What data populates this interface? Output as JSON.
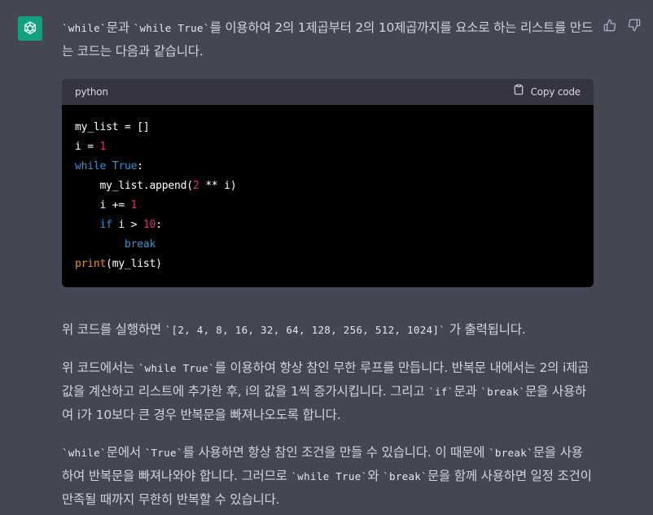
{
  "intro": {
    "c1": "`while`",
    "t1": "문과 ",
    "c2": "`while True`",
    "t2": "를 이용하여 2의 1제곱부터 2의 10제곱까지를 요소로 하는 리스트를 만드는 코드는 다음과 같습니다."
  },
  "code": {
    "language": "python",
    "copy_label": "Copy code",
    "l1": "my_list = []",
    "l2a": "i = ",
    "l2b": "1",
    "l3a": "while",
    "l3b": " ",
    "l3c": "True",
    "l3d": ":",
    "l4a": "    my_list.append(",
    "l4b": "2",
    "l4c": " ** i)",
    "l5a": "    i += ",
    "l5b": "1",
    "l6a": "    ",
    "l6b": "if",
    "l6c": " i > ",
    "l6d": "10",
    "l6e": ":",
    "l7a": "        ",
    "l7b": "break",
    "l8a": "print",
    "l8b": "(my_list)"
  },
  "result": {
    "t1": "위 코드를 실행하면 ",
    "c1": "`[2, 4, 8, 16, 32, 64, 128, 256, 512, 1024]`",
    "t2": " 가 출력됩니다."
  },
  "explain1": {
    "t1": "위 코드에서는 ",
    "c1": "`while True`",
    "t2": "를 이용하여 항상 참인 무한 루프를 만듭니다. 반복문 내에서는 2의 i제곱 값을 계산하고 리스트에 추가한 후, i의 값을 1씩 증가시킵니다. 그리고 ",
    "c2": "`if`",
    "t3": "문과 ",
    "c3": "`break`",
    "t4": "문을 사용하여 i가 10보다 큰 경우 반복문을 빠져나오도록 합니다."
  },
  "explain2": {
    "c1": "`while`",
    "t1": "문에서 ",
    "c2": "`True`",
    "t2": "를 사용하면 항상 참인 조건을 만들 수 있습니다. 이 때문에 ",
    "c3": "`break`",
    "t3": "문을 사용하여 반복문을 빠져나와야 합니다. 그러므로 ",
    "c4": "`while True`",
    "t4": "와 ",
    "c5": "`break`",
    "t5": "문을 함께 사용하면 일정 조건이 만족될 때까지 무한히 반복할 수 있습니다."
  },
  "icons": {
    "avatar": "chatgpt-logo-icon",
    "like": "thumbs-up-icon",
    "dislike": "thumbs-down-icon",
    "copy": "clipboard-icon"
  },
  "colors": {
    "background": "#444654",
    "avatar": "#10a37f",
    "code_bg": "#000000",
    "code_header": "#343541",
    "keyword": "#2e95d3",
    "number": "#df3079",
    "print": "#e9950c"
  }
}
